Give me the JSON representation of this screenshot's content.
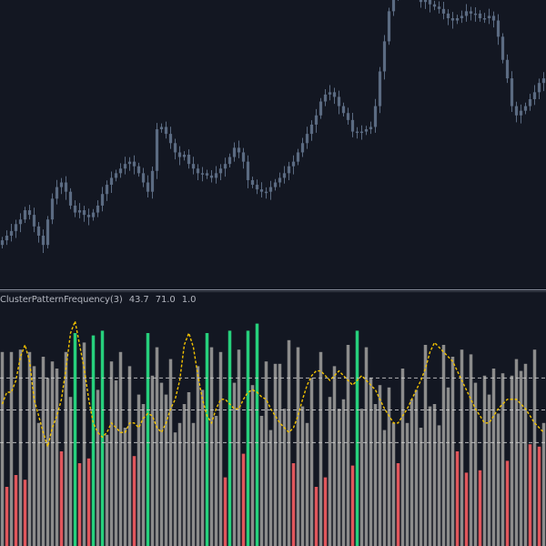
{
  "indicator": {
    "name": "ClusterPatternFrequency(3)",
    "values": [
      "43.7",
      "71.0",
      "1.0"
    ]
  },
  "colors": {
    "background": "#131722",
    "candle": "#5b6b82",
    "separator": "#8a8f9c",
    "signal_line": "#f2c200",
    "bar_neutral": "#8c8c8c",
    "bar_high": "#26d07c",
    "bar_low": "#e0565b",
    "level_line": "#d0d0d0",
    "title_text": "#b2b5be"
  },
  "chart_data": [
    {
      "type": "candlestick",
      "title": "",
      "grid": false,
      "closes": [
        0.22,
        0.24,
        0.26,
        0.29,
        0.31,
        0.35,
        0.33,
        0.28,
        0.24,
        0.2,
        0.31,
        0.4,
        0.45,
        0.47,
        0.43,
        0.37,
        0.34,
        0.35,
        0.33,
        0.32,
        0.34,
        0.37,
        0.42,
        0.46,
        0.49,
        0.51,
        0.53,
        0.55,
        0.56,
        0.54,
        0.51,
        0.47,
        0.43,
        0.52,
        0.7,
        0.71,
        0.68,
        0.64,
        0.6,
        0.58,
        0.59,
        0.55,
        0.53,
        0.51,
        0.51,
        0.5,
        0.49,
        0.51,
        0.53,
        0.55,
        0.58,
        0.62,
        0.6,
        0.56,
        0.48,
        0.46,
        0.44,
        0.43,
        0.43,
        0.45,
        0.47,
        0.49,
        0.51,
        0.54,
        0.56,
        0.6,
        0.64,
        0.68,
        0.72,
        0.76,
        0.82,
        0.85,
        0.86,
        0.84,
        0.8,
        0.77,
        0.74,
        0.69,
        0.69,
        0.69,
        0.7,
        0.71,
        0.8,
        0.95,
        1.08,
        1.21,
        1.28,
        1.31,
        1.32,
        1.31,
        1.3,
        1.29,
        1.25,
        1.27,
        1.24,
        1.23,
        1.22,
        1.2,
        1.18,
        1.17,
        1.18,
        1.19,
        1.21,
        1.2,
        1.2,
        1.18,
        1.18,
        1.19,
        1.17,
        1.1,
        1.0,
        0.92,
        0.8,
        0.76,
        0.78,
        0.8,
        0.83,
        0.86,
        0.9,
        0.92
      ]
    },
    {
      "type": "bar",
      "title": "ClusterPatternFrequency(3)",
      "ylim": [
        0,
        100
      ],
      "levels": [
        71.0,
        57.5,
        43.7
      ],
      "values": [
        82,
        25,
        82,
        30,
        83,
        28,
        82,
        76,
        52,
        80,
        71,
        78,
        75,
        40,
        82,
        63,
        90,
        35,
        86,
        37,
        89,
        66,
        91,
        47,
        78,
        70,
        82,
        50,
        76,
        38,
        64,
        60,
        90,
        72,
        84,
        69,
        64,
        79,
        48,
        52,
        60,
        65,
        52,
        76,
        66,
        90,
        84,
        55,
        82,
        29,
        91,
        69,
        83,
        39,
        91,
        68,
        94,
        55,
        78,
        49,
        77,
        77,
        58,
        87,
        35,
        84,
        59,
        52,
        71,
        25,
        82,
        29,
        63,
        76,
        58,
        62,
        85,
        34,
        91,
        58,
        84,
        71,
        60,
        68,
        49,
        67,
        52,
        35,
        75,
        52,
        62,
        66,
        50,
        85,
        59,
        60,
        51,
        85,
        67,
        80,
        40,
        83,
        31,
        81,
        69,
        32,
        72,
        64,
        75,
        56,
        73,
        36,
        72,
        79,
        74,
        77,
        43,
        83,
        42,
        52
      ],
      "signal": [
        60,
        65,
        65,
        70,
        80,
        85,
        78,
        62,
        55,
        48,
        42,
        50,
        55,
        62,
        75,
        90,
        95,
        85,
        75,
        62,
        52,
        48,
        46,
        48,
        52,
        50,
        48,
        48,
        52,
        52,
        50,
        54,
        56,
        55,
        50,
        48,
        52,
        58,
        62,
        70,
        85,
        90,
        84,
        72,
        62,
        55,
        52,
        58,
        62,
        62,
        60,
        58,
        58,
        62,
        65,
        66,
        65,
        63,
        62,
        58,
        55,
        52,
        50,
        48,
        50,
        55,
        62,
        68,
        72,
        74,
        74,
        72,
        70,
        72,
        74,
        72,
        70,
        68,
        70,
        72,
        70,
        68,
        66,
        62,
        58,
        55,
        52,
        52,
        55,
        58,
        62,
        66,
        70,
        75,
        82,
        86,
        84,
        82,
        80,
        78,
        74,
        70,
        66,
        62,
        58,
        55,
        52,
        52,
        55,
        58,
        60,
        62,
        62,
        62,
        60,
        58,
        55,
        52,
        50,
        48
      ]
    }
  ]
}
